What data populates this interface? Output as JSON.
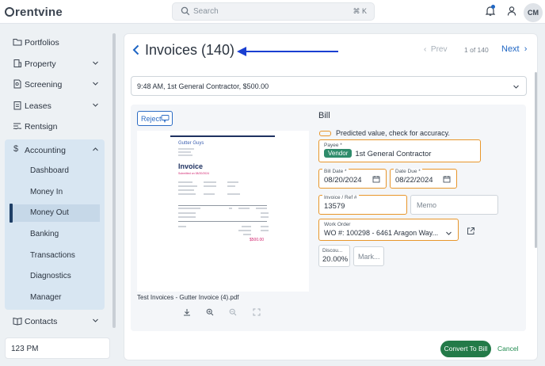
{
  "app": {
    "logo": "rentvine"
  },
  "topbar": {
    "search_placeholder": "Search",
    "search_shortcut": "⌘ K",
    "avatar_initials": "CM"
  },
  "sidebar": {
    "items": [
      {
        "label": "Portfolios",
        "icon": "folder-icon"
      },
      {
        "label": "Property",
        "icon": "building-icon"
      },
      {
        "label": "Screening",
        "icon": "document-search-icon"
      },
      {
        "label": "Leases",
        "icon": "clipboard-icon"
      },
      {
        "label": "Rentsign",
        "icon": "signature-icon"
      },
      {
        "label": "Accounting",
        "icon": "dollar-icon"
      },
      {
        "label": "Contacts",
        "icon": "book-icon"
      }
    ],
    "accounting_sub": [
      "Dashboard",
      "Money In",
      "Money Out",
      "Banking",
      "Transactions",
      "Diagnostics",
      "Manager"
    ],
    "active_sub": "Money Out",
    "bottom_text": "123 PM"
  },
  "header": {
    "title": "Invoices (140)",
    "prev_label": "Prev",
    "page_info": "1 of 140",
    "next_label": "Next"
  },
  "transaction": {
    "selected": "9:48 AM, 1st General Contractor, $500.00"
  },
  "document": {
    "reject_label": "Reject",
    "preview": {
      "company": "Gutter Guys",
      "heading": "Invoice",
      "subheading": "Submitted on 08/20/2024",
      "total": "$500.00"
    },
    "file_name": "Test Invoices - Gutter Invoice (4).pdf"
  },
  "bill": {
    "title": "Bill",
    "predicted_note": "Predicted value, check for accuracy.",
    "payee_label": "Payee *",
    "payee_tag": "Vendor",
    "payee_value": "1st General Contractor",
    "bill_date_label": "Bill Date *",
    "bill_date": "08/20/2024",
    "due_date_label": "Date Due *",
    "due_date": "08/22/2024",
    "invoice_ref_label": "Invoice / Ref #",
    "invoice_ref": "13579",
    "memo_placeholder": "Memo",
    "work_order_label": "Work Order",
    "work_order": "WO #: 100298 - 6461 Aragon Way...",
    "discount_label": "Discou...",
    "discount": "20.00%",
    "markup_placeholder": "Mark..."
  },
  "actions": {
    "convert_label": "Convert To Bill",
    "cancel_label": "Cancel"
  },
  "colors": {
    "accent": "#1f66c4",
    "warning": "#e8962b",
    "success": "#237a48",
    "vendor_tag": "#2e8b6b",
    "arrow": "#1a3fd1"
  }
}
